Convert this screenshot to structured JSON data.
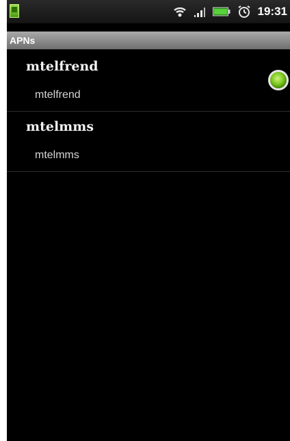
{
  "status_bar": {
    "time": "19:31",
    "icons": [
      "wifi-icon",
      "signal-icon",
      "battery-icon",
      "alarm-icon"
    ]
  },
  "title_bar": {
    "title": "APNs"
  },
  "apns": [
    {
      "name": "mtelfrend",
      "value": "mtelfrend",
      "selected": true
    },
    {
      "name": "mtelmms",
      "value": "mtelmms",
      "selected": false
    }
  ],
  "colors": {
    "background": "#000000",
    "title_bar": "#8c8c8c",
    "radio_selected": "#7cc61e"
  }
}
